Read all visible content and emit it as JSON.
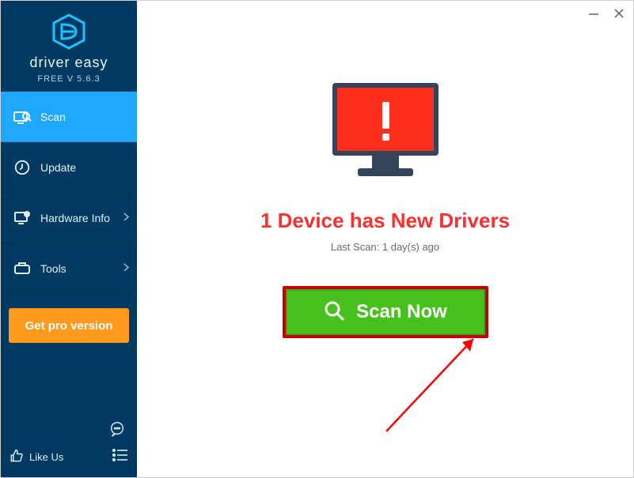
{
  "brand": {
    "name": "driver easy",
    "version": "FREE V 5.6.3"
  },
  "sidebar": {
    "items": [
      {
        "label": "Scan",
        "active": true,
        "has_arrow": false
      },
      {
        "label": "Update",
        "active": false,
        "has_arrow": false
      },
      {
        "label": "Hardware Info",
        "active": false,
        "has_arrow": true
      },
      {
        "label": "Tools",
        "active": false,
        "has_arrow": true
      }
    ],
    "pro_button": "Get pro version",
    "like_us": "Like Us"
  },
  "main": {
    "headline": "1 Device has New Drivers",
    "last_scan": "Last Scan: 1 day(s) ago",
    "scan_button": "Scan Now"
  },
  "colors": {
    "sidebar_bg": "#003a60",
    "sidebar_active": "#1fa8ff",
    "accent_orange": "#ff9a1d",
    "alert_red": "#fc2f2f",
    "scan_green": "#47c21d"
  }
}
